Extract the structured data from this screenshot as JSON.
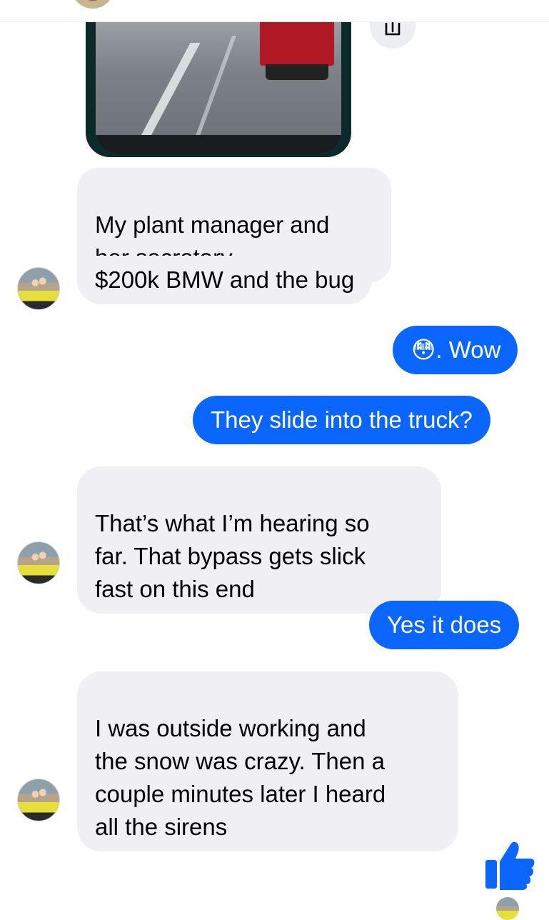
{
  "colors": {
    "outgoing_bubble": "#0a66ff",
    "incoming_bubble": "#f0f0f4",
    "like_icon": "#0a66ff"
  },
  "messages": [
    {
      "from": "them",
      "text": "My plant manager and\nher secretary"
    },
    {
      "from": "them",
      "text": "$200k BMW and the bug"
    },
    {
      "from": "me",
      "emoji": "😳",
      "text": ". Wow"
    },
    {
      "from": "me",
      "text": "They slide into the truck?"
    },
    {
      "from": "them",
      "text": "That’s what I’m hearing so\nfar. That bypass gets slick\nfast on this end"
    },
    {
      "from": "me",
      "text": "Yes it does"
    },
    {
      "from": "them",
      "text": "I was outside working and\nthe snow was crazy. Then a\ncouple minutes later I heard\nall the sirens"
    }
  ],
  "icons": {
    "share": "share-icon",
    "like": "thumbs-up-icon"
  }
}
